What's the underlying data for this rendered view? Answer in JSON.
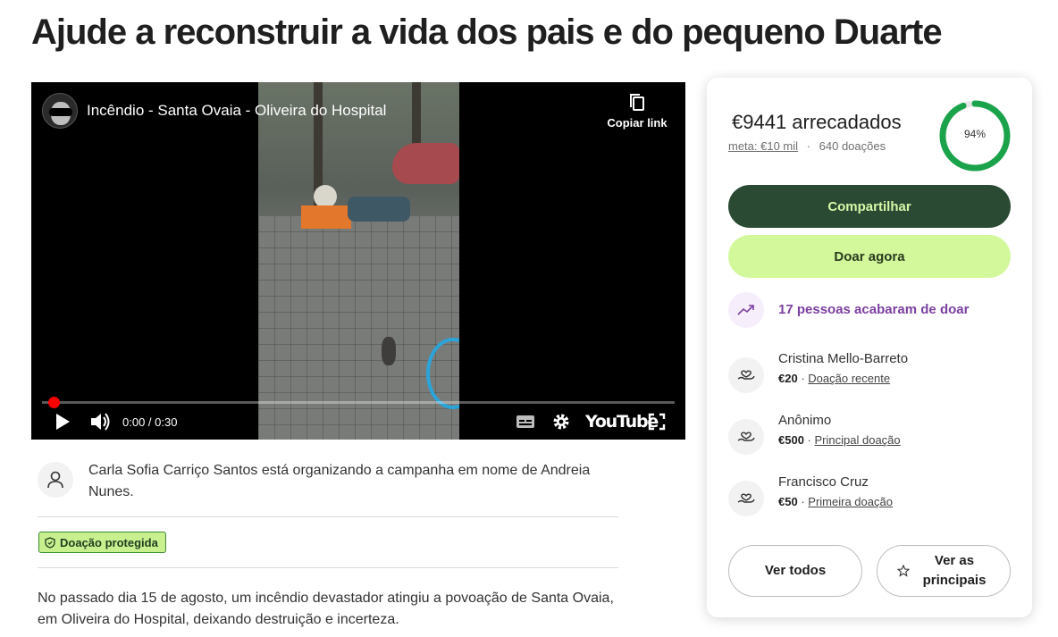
{
  "page": {
    "title": "Ajude a reconstruir a vida dos pais e do pequeno Duarte"
  },
  "video": {
    "title": "Incêndio - Santa Ovaia - Oliveira do Hospital",
    "copy_link_label": "Copiar link",
    "time": "0:00 / 0:30",
    "youtube_label": "YouTube",
    "progress": 0
  },
  "organizer": {
    "text": "Carla Sofia Carriço Santos está organizando a campanha em nome de Andreia Nunes."
  },
  "badge": {
    "label": "Doação protegida"
  },
  "story": {
    "text": "No passado dia 15 de agosto, um incêndio devastador atingiu a povoação de Santa Ovaia, em Oliveira do Hospital, deixando destruição e incerteza."
  },
  "card": {
    "raised": "€9441 arrecadados",
    "goal": "meta: €10 mil",
    "separator": "·",
    "donations": "640 doações",
    "percent_label": "94%",
    "percent": 0.94,
    "share_label": "Compartilhar",
    "donate_label": "Doar agora",
    "recent_text": "17 pessoas acabaram de doar",
    "donors": [
      {
        "name": "Cristina Mello-Barreto",
        "amount": "€20",
        "sep": "·",
        "tag": "Doação recente"
      },
      {
        "name": "Anônimo",
        "amount": "€500",
        "sep": "·",
        "tag": "Principal doação"
      },
      {
        "name": "Francisco Cruz",
        "amount": "€50",
        "sep": "·",
        "tag": "Primeira doação"
      }
    ],
    "see_all_label": "Ver todos",
    "see_top_label": "Ver as principais"
  },
  "colors": {
    "accent_dark": "#2a4a33",
    "accent_light": "#d2f89b",
    "ring": "#1aa34a",
    "recent_purple": "#7b3fa0",
    "youtube_red": "#ff0000"
  }
}
